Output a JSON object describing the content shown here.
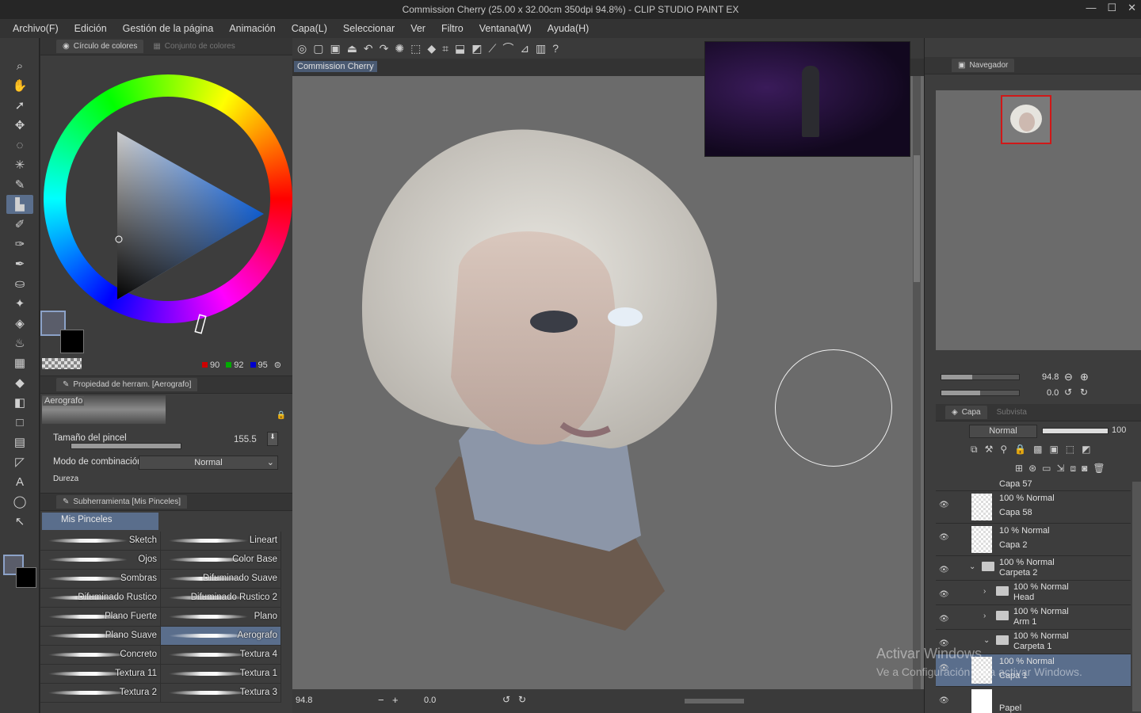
{
  "window": {
    "title": "Commission Cherry (25.00 x 32.00cm 350dpi 94.8%)  - CLIP STUDIO PAINT EX"
  },
  "menu": [
    "Archivo(F)",
    "Edición",
    "Gestión de la página",
    "Animación",
    "Capa(L)",
    "Seleccionar",
    "Ver",
    "Filtro",
    "Ventana(W)",
    "Ayuda(H)"
  ],
  "tools": [
    "pen-icon",
    "zoom-icon",
    "hand-icon",
    "operation-icon",
    "move-icon",
    "lasso-icon",
    "magic-wand-icon",
    "eyedropper-icon",
    "airbrush-icon",
    "pencil-icon",
    "brush-icon",
    "decoration-icon",
    "fill-icon",
    "sparkle-icon",
    "eraser-icon",
    "blend-icon",
    "frame-icon",
    "bucket-icon",
    "gradient-icon",
    "rect-icon",
    "panel-icon",
    "ruler-icon",
    "text-icon",
    "balloon-icon",
    "correct-line-icon"
  ],
  "color_panel": {
    "tab_active": "Círculo de colores",
    "tab_inactive": "Conjunto de colores",
    "rgb": {
      "r": "90",
      "g": "92",
      "b": "95"
    },
    "main_color": "#5a5d6a",
    "sub_color": "#000000"
  },
  "tool_property": {
    "tab": "Propiedad de herram. [Aerografo]",
    "preview_label": "Aerografo",
    "brush_size_label": "Tamaño del pincel",
    "brush_size_value": "155.5",
    "blend_label": "Modo de combinación",
    "blend_value": "Normal",
    "hardness_label": "Dureza"
  },
  "subtool": {
    "tab": "Subherramienta [Mis Pinceles]",
    "group": "Mis Pinceles",
    "brushes": [
      "Sketch",
      "Lineart",
      "Ojos",
      "Color Base",
      "Sombras",
      "Difuminado Suave",
      "Difuminado Rustico",
      "Difuminado Rustico 2",
      "Plano Fuerte",
      "Plano",
      "Plano Suave",
      "Aerografo",
      "Concreto",
      "Textura 4",
      "Textura 11",
      "Textura 1",
      "Textura 2",
      "Textura 3"
    ],
    "selected": "Aerografo"
  },
  "canvas": {
    "doc_tab": "Commission Cherry",
    "zoom": "94.8",
    "rotation": "0.0"
  },
  "navigator": {
    "tab": "Navegador",
    "zoom": "94.8",
    "rotation": "0.0"
  },
  "layer_panel": {
    "tab": "Capa",
    "tab2": "Subvista",
    "blend": "Normal",
    "opacity": "100",
    "layers": [
      {
        "mode": "100 % Normal",
        "name": "Capa 58",
        "type": "layer"
      },
      {
        "mode": "10 % Normal",
        "name": "Capa 2",
        "type": "layer"
      },
      {
        "mode": "100 % Normal",
        "name": "Carpeta 2",
        "type": "folder"
      },
      {
        "mode": "100 % Normal",
        "name": "Head",
        "type": "folder"
      },
      {
        "mode": "100 % Normal",
        "name": "Arm 1",
        "type": "folder"
      },
      {
        "mode": "100 % Normal",
        "name": "Carpeta 1",
        "type": "folder"
      },
      {
        "mode": "100 % Normal",
        "name": "Capa 1",
        "type": "layer"
      },
      {
        "mode": "",
        "name": "Papel",
        "type": "paper"
      }
    ],
    "partial_top": "Capa 57"
  },
  "watermark": {
    "line1": "Activar Windows",
    "line2": "Ve a Configuración para activar Windows."
  }
}
